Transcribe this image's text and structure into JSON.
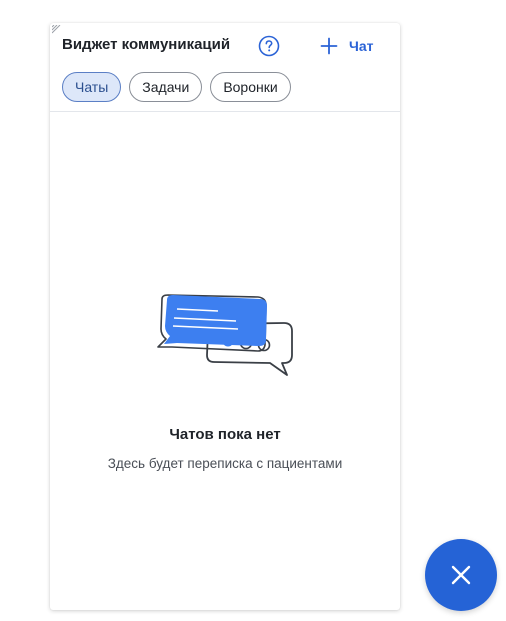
{
  "widget": {
    "title": "Виджет коммуникаций",
    "new_chat_label": "Чат",
    "tabs": [
      {
        "label": "Чаты",
        "active": true
      },
      {
        "label": "Задачи",
        "active": false
      },
      {
        "label": "Воронки",
        "active": false
      }
    ],
    "empty_state": {
      "title": "Чатов пока нет",
      "subtitle": "Здесь будет переписка с пациентами"
    }
  },
  "icons": {
    "resize_handle": "resize-handle-icon",
    "help": "question-circle-icon",
    "new_chat": "plus-icon",
    "illustration": "chat-bubbles-illustration",
    "fab": "close-icon"
  },
  "colors": {
    "accent": "#2563d6",
    "active_tab_bg": "#dde7f9",
    "bubble_blue": "#3d7ff0"
  }
}
